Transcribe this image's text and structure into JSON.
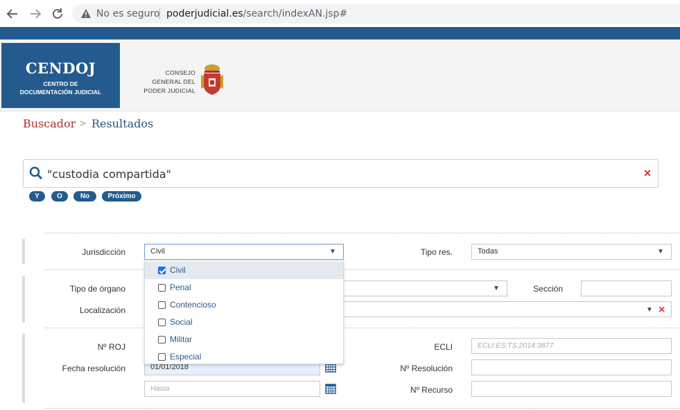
{
  "browser": {
    "back_icon": "arrow-left-icon",
    "forward_icon": "arrow-right-icon",
    "reload_icon": "reload-icon",
    "security_label": "No es seguro",
    "url_domain": "poderjudicial.es",
    "url_path": "/search/indexAN.jsp#"
  },
  "header": {
    "logo_title": "CENDOJ",
    "logo_sub1": "CENTRO DE",
    "logo_sub2": "DOCUMENTACIÓN JUDICIAL",
    "cgpj_line1": "CONSEJO",
    "cgpj_line2": "GENERAL DEL",
    "cgpj_line3": "PODER JUDICIAL",
    "brand_color": "#245b8e"
  },
  "breadcrumb": {
    "search": "Buscador",
    "separator": ">",
    "results": "Resultados"
  },
  "search": {
    "query": "\"custodia compartida\"",
    "clear_label": "×",
    "operators": [
      "Y",
      "O",
      "No",
      "Próximo"
    ]
  },
  "form": {
    "jurisdiccion_label": "Jurisdicción",
    "jurisdiccion_value": "Civil",
    "tipo_res_label": "Tipo res.",
    "tipo_res_value": "Todas",
    "tipo_organo_label": "Tipo de órgano",
    "seccion_label": "Sección",
    "localizacion_label": "Localización",
    "localizacion_clear": "×",
    "roj_label": "Nº ROJ",
    "ecli_label": "ECLI",
    "ecli_placeholder": "ECLI:ES:TS:2014:3877",
    "fecha_label": "Fecha resolución",
    "fecha_desde": "01/01/2018",
    "fecha_hasta_placeholder": "Hasta",
    "n_resolucion_label": "Nº Resolución",
    "n_recurso_label": "Nº Recurso",
    "caret": "▼"
  },
  "dropdown": {
    "options": [
      {
        "label": "Civil",
        "checked": true
      },
      {
        "label": "Penal",
        "checked": false
      },
      {
        "label": "Contencioso",
        "checked": false
      },
      {
        "label": "Social",
        "checked": false
      },
      {
        "label": "Militar",
        "checked": false
      },
      {
        "label": "Especial",
        "checked": false
      }
    ]
  }
}
